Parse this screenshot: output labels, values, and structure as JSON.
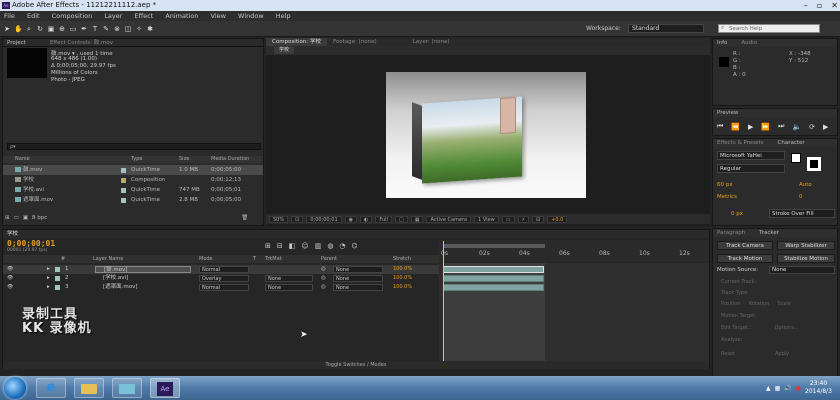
{
  "titlebar": {
    "title": "Adobe After Effects - 11212211112.aep *"
  },
  "menu": [
    "File",
    "Edit",
    "Composition",
    "Layer",
    "Effect",
    "Animation",
    "View",
    "Window",
    "Help"
  ],
  "toolbar": {
    "workspace_label": "Workspace:",
    "workspace_value": "Standard",
    "search_placeholder": "Search Help"
  },
  "project": {
    "tab": "Project",
    "tab2": "Effect Controls: 鼓.mov",
    "info_name": "鼓.mov ▾ , used 1 time",
    "info_size": "648 x 486 (1.00)",
    "info_dur": "Δ 0;00;05;00, 29.97 fps",
    "info_colors": "Millions of Colors",
    "info_codec": "Photo - JPEG",
    "search": "ρ▾",
    "cols": [
      "Name",
      "Type",
      "Size",
      "Media Duration"
    ],
    "items": [
      {
        "name": "鼓.mov",
        "type": "QuickTime",
        "size": "1.0 MB",
        "dur": "0;00;05;00",
        "color": "#a6c3c1"
      },
      {
        "name": "学校",
        "type": "Composition",
        "size": "",
        "dur": "0;00;12;13",
        "color": "#b9a86a"
      },
      {
        "name": "学校.avi",
        "type": "QuickTime",
        "size": "747 MB",
        "dur": "0;00;05;01",
        "color": "#a6c3c1"
      },
      {
        "name": "遮罩面.mov",
        "type": "QuickTime",
        "size": "2.8 MB",
        "dur": "0;00;05;00",
        "color": "#a6c3c1"
      }
    ],
    "bpc": "8 bpc"
  },
  "comp": {
    "tab": "Composition: 学校",
    "footage": "Footage: (none)",
    "layer": "Layer: (none)",
    "subtab": "学校",
    "zoom": "50%",
    "time": "0;00;00;01",
    "res": "Full",
    "camera": "Active Camera",
    "view": "1 View",
    "offset": "+0.0"
  },
  "info": {
    "tab": "Info",
    "tab2": "Audio",
    "r": "R :",
    "g": "G :",
    "b": "B :",
    "a": "A : 0",
    "x": "X : -348",
    "y": "Y : 512"
  },
  "preview": {
    "tab": "Preview"
  },
  "effects": {
    "tab": "Effects & Presets",
    "tab2": "Character"
  },
  "character": {
    "font": "Microsoft YaHei",
    "style": "Regular",
    "size": "60 px",
    "leading": "Auto",
    "kerning": "Metrics",
    "tracking": "0",
    "stroke_w": "0 px",
    "stroke": "Stroke Over Fill"
  },
  "tracker": {
    "tab": "Paragraph",
    "tab2": "Tracker",
    "track_camera": "Track Camera",
    "warp": "Warp Stabilizer",
    "track_motion": "Track Motion",
    "stabilize": "Stabilize Motion",
    "source_label": "Motion Source:",
    "source": "None",
    "current_track": "Current Track:",
    "track_type": "Track Type:",
    "position": "Position",
    "rotation": "Rotation",
    "scale": "Scale",
    "target": "Motion Target:",
    "edit_target": "Edit Target...",
    "options": "Options...",
    "analyze": "Analyze:",
    "reset": "Reset",
    "apply": "Apply"
  },
  "timeline": {
    "tab": "学校",
    "timecode": "0;00;00;01",
    "fps": "00001 (29.97 fps)",
    "cols": [
      "#",
      "Layer Name",
      "Mode",
      "T",
      "TrkMat",
      "Parent",
      "Stretch"
    ],
    "layers": [
      {
        "num": "1",
        "name": "[鼓.mov]",
        "mode": "Normal",
        "trkmat": "",
        "parent": "None",
        "stretch": "100.0%"
      },
      {
        "num": "2",
        "name": "[学校.avi]",
        "mode": "Overlay",
        "trkmat": "None",
        "parent": "None",
        "stretch": "100.0%"
      },
      {
        "num": "3",
        "name": "[遮罩面.mov]",
        "mode": "Normal",
        "trkmat": "None",
        "parent": "None",
        "stretch": "100.0%"
      }
    ],
    "ruler": [
      "0s",
      "02s",
      "04s",
      "06s",
      "08s",
      "10s",
      "12s"
    ],
    "footer": "Toggle Switches / Modes"
  },
  "watermark": {
    "line1": "录制工具",
    "line2": "KK 录像机"
  },
  "taskbar": {
    "time": "23:40",
    "date": "2014/8/3"
  }
}
